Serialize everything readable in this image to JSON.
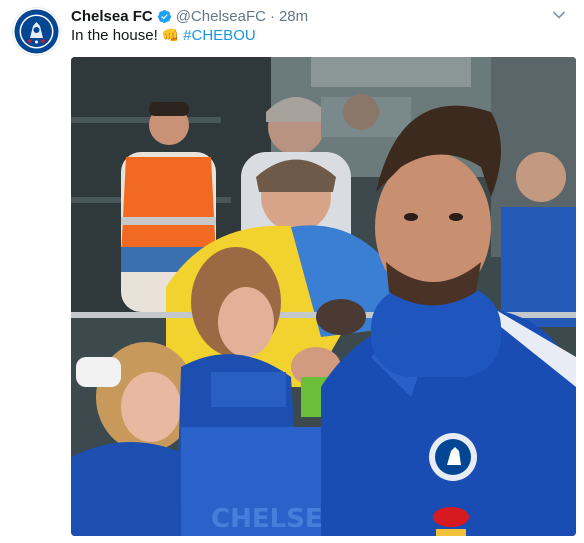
{
  "tweet": {
    "author_name": "Chelsea FC",
    "author_handle": "@ChelseaFC",
    "separator": "·",
    "time": "28m",
    "text_main": "In the house!",
    "emoji": "👊",
    "hashtag": "#CHEBOU",
    "avatar_icon": "chelsea-crest",
    "verified_icon": "verified-badge",
    "menu_icon": "chevron-down",
    "media_description_icon": "video-still"
  },
  "colors": {
    "name": "#14171a",
    "meta": "#657786",
    "link": "#1b95e0",
    "verified": "#1da1f2",
    "chelsea_blue": "#034694"
  }
}
